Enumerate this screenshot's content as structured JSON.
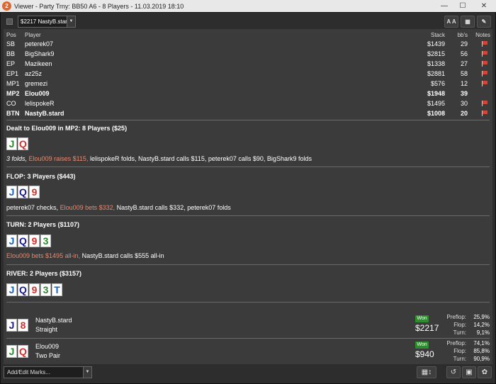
{
  "window": {
    "title": "Viewer - Party Trny: BB50 A6 - 8 Players - 11.03.2019 18:10",
    "icon_label": "2"
  },
  "toolbar": {
    "selected_player": "$2217 NastyB.stard",
    "font_button": "A A"
  },
  "table": {
    "headers": {
      "pos": "Pos",
      "player": "Player",
      "stack": "Stack",
      "bbs": "bb's",
      "notes": "Notes"
    },
    "rows": [
      {
        "pos": "SB",
        "player": "peterek07",
        "stack": "$1439",
        "bbs": "29",
        "flag": true
      },
      {
        "pos": "BB",
        "player": "BigShark9",
        "stack": "$2815",
        "bbs": "56",
        "flag": true
      },
      {
        "pos": "EP",
        "player": "Mazikeen",
        "stack": "$1338",
        "bbs": "27",
        "flag": true
      },
      {
        "pos": "EP1",
        "player": "az25z",
        "stack": "$2881",
        "bbs": "58",
        "flag": true
      },
      {
        "pos": "MP1",
        "player": "gremezi",
        "stack": "$576",
        "bbs": "12",
        "flag": true
      },
      {
        "pos": "MP2",
        "player": "Elou009",
        "stack": "$1948",
        "bbs": "39",
        "flag": false
      },
      {
        "pos": "CO",
        "player": "lelispokeR",
        "stack": "$1495",
        "bbs": "30",
        "flag": true
      },
      {
        "pos": "BTN",
        "player": "NastyB.stard",
        "stack": "$1008",
        "bbs": "20",
        "flag": true
      }
    ]
  },
  "streets": {
    "preflop": {
      "title": "Dealt to Elou009 in MP2: 8 Players ($25)",
      "cards": [
        {
          "rank": "J",
          "suit": "clubs"
        },
        {
          "rank": "Q",
          "suit": "hearts"
        }
      ],
      "folds": "3 folds,",
      "hero": "Elou009 raises $115,",
      "rest": "lelispokeR folds, NastyB.stard calls $115, peterek07 calls $90, BigShark9 folds"
    },
    "flop": {
      "title": "FLOP: 3 Players ($443)",
      "cards": [
        {
          "rank": "J",
          "suit": "diamonds"
        },
        {
          "rank": "Q",
          "suit": "spades"
        },
        {
          "rank": "9",
          "suit": "hearts"
        }
      ],
      "pre": "peterek07 checks,",
      "hero": "Elou009 bets $332,",
      "rest": "NastyB.stard calls $332, peterek07 folds"
    },
    "turn": {
      "title": "TURN: 2 Players ($1107)",
      "cards": [
        {
          "rank": "J",
          "suit": "diamonds"
        },
        {
          "rank": "Q",
          "suit": "spades"
        },
        {
          "rank": "9",
          "suit": "hearts"
        },
        {
          "rank": "3",
          "suit": "clubs"
        }
      ],
      "hero": "Elou009 bets $1495 all-in,",
      "rest": "NastyB.stard calls $555 all-in"
    },
    "river": {
      "title": "RIVER: 2 Players ($3157)",
      "cards": [
        {
          "rank": "J",
          "suit": "diamonds"
        },
        {
          "rank": "Q",
          "suit": "spades"
        },
        {
          "rank": "9",
          "suit": "hearts"
        },
        {
          "rank": "3",
          "suit": "clubs"
        },
        {
          "rank": "T",
          "suit": "diamonds"
        }
      ]
    }
  },
  "results": [
    {
      "name": "NastyB.stard",
      "hand": "Straight",
      "cards": [
        {
          "rank": "J",
          "suit": "spades"
        },
        {
          "rank": "8",
          "suit": "hearts"
        }
      ],
      "won_label": "Won",
      "amount": "$2217",
      "stats": [
        {
          "label": "Preflop:",
          "value": "25,9%"
        },
        {
          "label": "Flop:",
          "value": "14,2%"
        },
        {
          "label": "Turn:",
          "value": "9,1%"
        }
      ]
    },
    {
      "name": "Elou009",
      "hand": "Two Pair",
      "cards": [
        {
          "rank": "J",
          "suit": "clubs"
        },
        {
          "rank": "Q",
          "suit": "hearts"
        }
      ],
      "won_label": "Won",
      "amount": "$940",
      "stats": [
        {
          "label": "Preflop:",
          "value": "74,1%"
        },
        {
          "label": "Flop:",
          "value": "85,8%"
        },
        {
          "label": "Turn:",
          "value": "90,9%"
        }
      ]
    }
  ],
  "bottom": {
    "marks_placeholder": "Add/Edit Marks..."
  }
}
